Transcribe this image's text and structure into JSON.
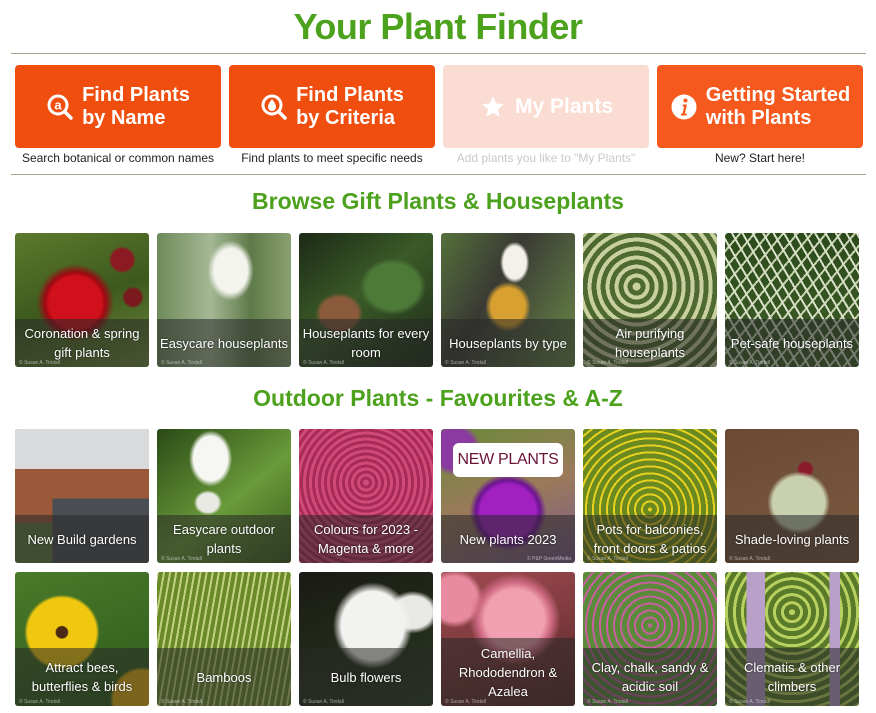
{
  "header": {
    "title": "Your Plant Finder"
  },
  "actions": [
    {
      "label_line1": "Find Plants",
      "label_line2": "by Name",
      "subtitle": "Search botanical or common names",
      "icon": "search-at-icon",
      "enabled": true,
      "color": "#f04e0f"
    },
    {
      "label_line1": "Find Plants",
      "label_line2": "by Criteria",
      "subtitle": "Find plants to meet specific needs",
      "icon": "search-drop-icon",
      "enabled": true,
      "color": "#f04e0f"
    },
    {
      "label_line1": "My Plants",
      "label_line2": "",
      "subtitle": "Add plants you like to \"My Plants\"",
      "icon": "star-icon",
      "enabled": false,
      "color": "#fadcd2"
    },
    {
      "label_line1": "Getting Started",
      "label_line2": "with Plants",
      "subtitle": "New? Start here!",
      "icon": "info-icon",
      "enabled": true,
      "color": "#f5591e"
    }
  ],
  "sections": [
    {
      "title": "Browse Gift Plants & Houseplants",
      "tiles": [
        {
          "caption": "Coronation & spring gift plants",
          "credit": "© Susan A. Tindall"
        },
        {
          "caption": "Easycare houseplants",
          "credit": "© Susan A. Tindall"
        },
        {
          "caption": "Houseplants for every room",
          "credit": "© Susan A. Tindall"
        },
        {
          "caption": "Houseplants by type",
          "credit": "© Susan A. Tindall"
        },
        {
          "caption": "Air purifying houseplants",
          "credit": "© Susan A. Tindall"
        },
        {
          "caption": "Pet-safe houseplants",
          "credit": "© Susan A. Tindall"
        }
      ]
    },
    {
      "title": "Outdoor Plants - Favourites & A-Z",
      "tiles": [
        {
          "caption": "New Build gardens",
          "credit": ""
        },
        {
          "caption": "Easycare outdoor plants",
          "credit": "© Susan A. Tindall"
        },
        {
          "caption": "Colours for 2023 - Magenta & more",
          "credit": ""
        },
        {
          "caption": "New plants 2023",
          "credit": "© P&P GreenMedia",
          "badge": "NEW PLANTS"
        },
        {
          "caption": "Pots for balconies, front doors & patios",
          "credit": "© Susan A. Tindall"
        },
        {
          "caption": "Shade-loving plants",
          "credit": "© Susan A. Tindall"
        },
        {
          "caption": "Attract bees, butterflies & birds",
          "credit": "© Susan A. Tindall"
        },
        {
          "caption": "Bamboos",
          "credit": "© Susan A. Tindall"
        },
        {
          "caption": "Bulb flowers",
          "credit": "© Susan A. Tindall"
        },
        {
          "caption": "Camellia, Rhododendron & Azalea",
          "credit": "© Susan A. Tindall"
        },
        {
          "caption": "Clay, chalk, sandy & acidic soil",
          "credit": "© Susan A. Tindall"
        },
        {
          "caption": "Clematis & other climbers",
          "credit": "© Susan A. Tindall"
        }
      ]
    }
  ]
}
